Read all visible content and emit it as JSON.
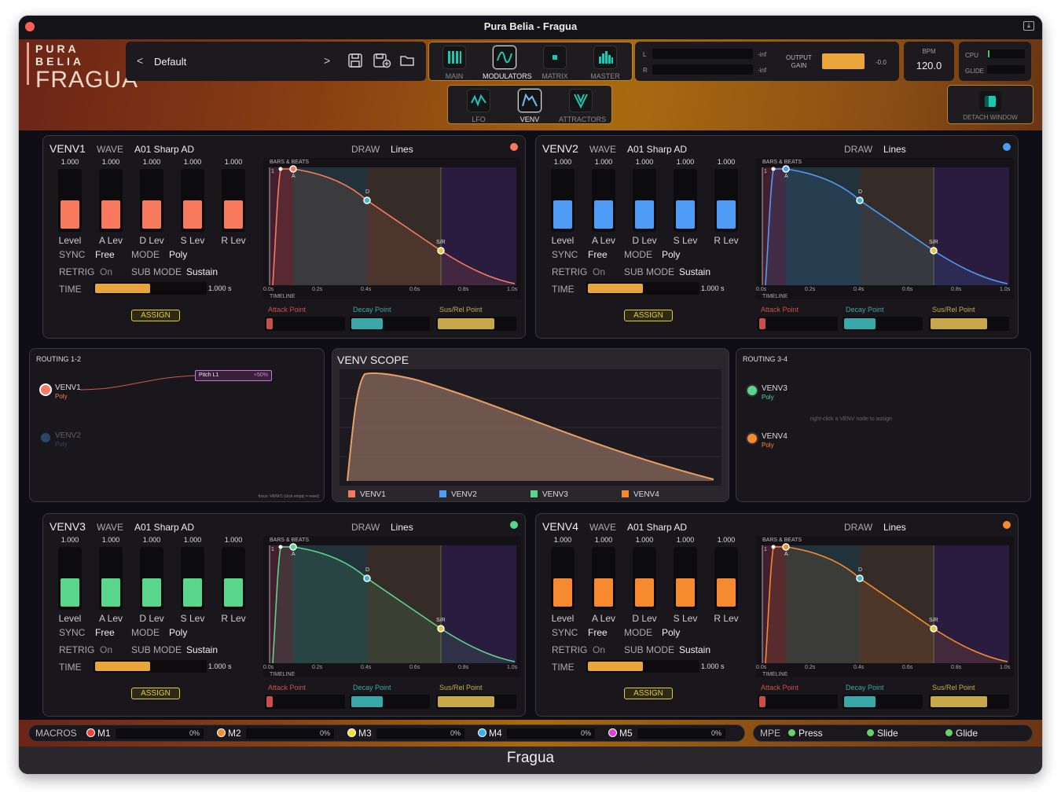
{
  "window": {
    "title": "Pura Belia - Fragua",
    "footer": "Fragua"
  },
  "logo": {
    "brand": "PURA BELIA",
    "product": "FRAGUA"
  },
  "preset": {
    "name": "Default",
    "prev": "<",
    "next": ">"
  },
  "main_tabs": [
    {
      "label": "MAIN",
      "icon": "bars-icon"
    },
    {
      "label": "MODULATORS",
      "icon": "wave-icon",
      "active": true
    },
    {
      "label": "MATRIX",
      "icon": "grid-icon"
    },
    {
      "label": "MASTER",
      "icon": "eq-icon"
    }
  ],
  "sub_tabs": [
    {
      "label": "LFO",
      "icon": "lfo-icon"
    },
    {
      "label": "VENV",
      "icon": "envelope-icon",
      "active": true
    },
    {
      "label": "ATTRACTORS",
      "icon": "attractor-icon"
    }
  ],
  "meter": {
    "l": "L",
    "r": "R",
    "l_val": "-inf",
    "r_val": "-inf",
    "output_gain_l1": "OUTPUT",
    "output_gain_l2": "GAIN",
    "gain_val": "-0.0"
  },
  "bpm": {
    "label": "BPM",
    "value": "120.0"
  },
  "cpu": {
    "label": "CPU",
    "glide": "GLIDE"
  },
  "detach": {
    "label": "DETACH WINDOW"
  },
  "labels": {
    "wave": "WAVE",
    "draw": "DRAW",
    "sync": "SYNC",
    "mode": "MODE",
    "retrig": "RETRIG",
    "submode": "SUB MODE",
    "time": "TIME",
    "assign": "ASSIGN",
    "bars_beats": "BARS & BEATS",
    "timeline": "TIMELINE",
    "attack_point": "Attack Point",
    "decay_point": "Decay Point",
    "susrel_point": "Sus/Rel Point",
    "slider_labels": [
      "Level",
      "A Lev",
      "D Lev",
      "S Lev",
      "R Lev"
    ],
    "ticks": [
      "0.0s",
      "0.2s",
      "0.4s",
      "0.6s",
      "0.8s",
      "1.0s"
    ],
    "pt_a": "A",
    "pt_d": "D",
    "pt_sr": "S/R",
    "bar1": "1"
  },
  "venvs": [
    {
      "name": "VENV1",
      "wave": "A01 Sharp AD",
      "draw": "Lines",
      "color": "#f77a5e",
      "slider_values": [
        "1.000",
        "1.000",
        "1.000",
        "1.000",
        "1.000"
      ],
      "sync": "Free",
      "mode": "Poly",
      "retrig": "On",
      "submode": "Sustain",
      "time": "1.000 s"
    },
    {
      "name": "VENV2",
      "wave": "A01 Sharp AD",
      "draw": "Lines",
      "color": "#4e9cf6",
      "slider_values": [
        "1.000",
        "1.000",
        "1.000",
        "1.000",
        "1.000"
      ],
      "sync": "Free",
      "mode": "Poly",
      "retrig": "On",
      "submode": "Sustain",
      "time": "1.000 s"
    },
    {
      "name": "VENV3",
      "wave": "A01 Sharp AD",
      "draw": "Lines",
      "color": "#5ad68c",
      "slider_values": [
        "1.000",
        "1.000",
        "1.000",
        "1.000",
        "1.000"
      ],
      "sync": "Free",
      "mode": "Poly",
      "retrig": "On",
      "submode": "Sustain",
      "time": "1.000 s"
    },
    {
      "name": "VENV4",
      "wave": "A01 Sharp AD",
      "draw": "Lines",
      "color": "#f78a2e",
      "slider_values": [
        "1.000",
        "1.000",
        "1.000",
        "1.000",
        "1.000"
      ],
      "sync": "Free",
      "mode": "Poly",
      "retrig": "On",
      "submode": "Sustain",
      "time": "1.000 s"
    }
  ],
  "routing12": {
    "title": "ROUTING 1-2",
    "nodes": [
      {
        "name": "VENV1",
        "sub": "Poly"
      },
      {
        "name": "VENV2",
        "sub": "Poly"
      }
    ],
    "target": {
      "label": "Pitch L1",
      "amount": "+50%"
    },
    "hint": "focus: VENV1 (click empty = reset)"
  },
  "scope": {
    "title": "VENV SCOPE",
    "legend": [
      "VENV1",
      "VENV2",
      "VENV3",
      "VENV4"
    ]
  },
  "routing34": {
    "title": "ROUTING 3-4",
    "nodes": [
      {
        "name": "VENV3",
        "sub": "Poly"
      },
      {
        "name": "VENV4",
        "sub": "Poly"
      }
    ],
    "hint": "right-click a VENV node to assign"
  },
  "macros": {
    "label": "MACROS",
    "items": [
      {
        "name": "M1",
        "value": "0%",
        "color": "#f0443a"
      },
      {
        "name": "M2",
        "value": "0%",
        "color": "#f09030"
      },
      {
        "name": "M3",
        "value": "0%",
        "color": "#f0e040"
      },
      {
        "name": "M4",
        "value": "0%",
        "color": "#3ab0f0"
      },
      {
        "name": "M5",
        "value": "0%",
        "color": "#e040e0"
      }
    ]
  },
  "mpe": {
    "label": "MPE",
    "items": [
      "Press",
      "Slide",
      "Glide"
    ],
    "color": "#6ad06a"
  }
}
